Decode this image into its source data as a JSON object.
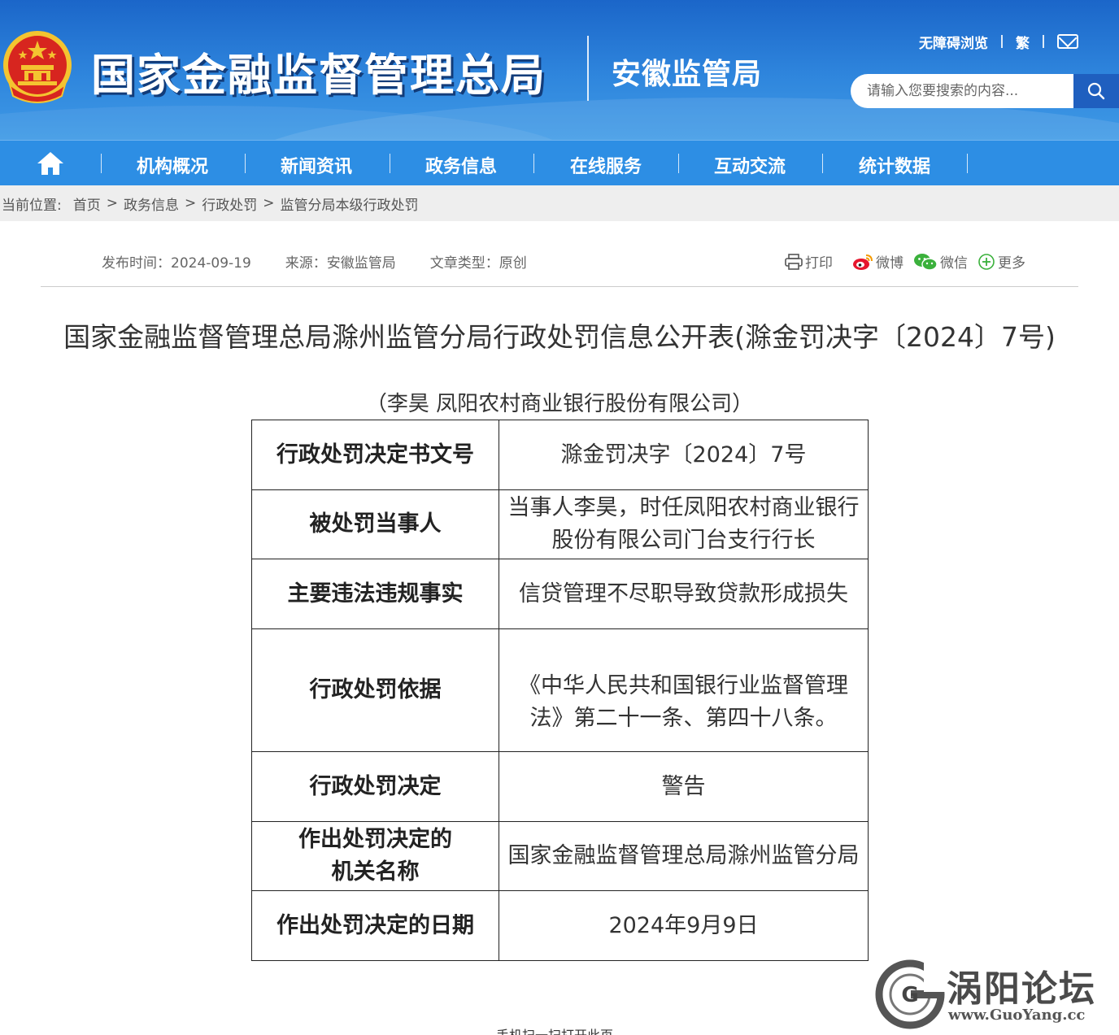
{
  "header": {
    "title": "国家金融监督管理总局",
    "subtitle": "安徽监管局",
    "accessibility_label": "无障碍浏览",
    "traditional_label": "繁",
    "search_placeholder": "请输入您要搜索的内容...",
    "icons": [
      "national-emblem",
      "mail-icon",
      "search-icon"
    ]
  },
  "nav": {
    "items": [
      "机构概况",
      "新闻资讯",
      "政务信息",
      "在线服务",
      "互动交流",
      "统计数据"
    ],
    "home_icon": "home-icon"
  },
  "breadcrumb": {
    "prefix": "当前位置:",
    "items": [
      "首页",
      "政务信息",
      "行政处罚",
      "监管分局本级行政处罚"
    ]
  },
  "article": {
    "publish": "发布时间：2024-09-19",
    "source": "来源：安徽监管局",
    "type": "文章类型：原创",
    "share": {
      "print": "打印",
      "weibo": "微博",
      "wechat": "微信",
      "more": "更多"
    },
    "title": "国家金融监督管理总局滁州监管分局行政处罚信息公开表(滁金罚决字〔2024〕7号)",
    "subtitle": "（李昊 凤阳农村商业银行股份有限公司）",
    "rows": [
      {
        "key": "行政处罚决定书文号",
        "value": "滁金罚决字〔2024〕7号"
      },
      {
        "key": "被处罚当事人",
        "value": "当事人李昊，时任凤阳农村商业银行股份有限公司门台支行行长"
      },
      {
        "key": "主要违法违规事实",
        "value": "信贷管理不尽职导致贷款形成损失"
      },
      {
        "key": "行政处罚依据",
        "value": "《中华人民共和国银行业监督管理法》第二十一条、第四十八条。"
      },
      {
        "key": "行政处罚决定",
        "value": "警告"
      },
      {
        "key": "作出处罚决定的机关名称",
        "value": "国家金融监督管理总局滁州监管分局"
      },
      {
        "key": "作出处罚决定的日期",
        "value": "2024年9月9日"
      }
    ],
    "qr_text": "手机扫一扫打开此页"
  },
  "watermark": {
    "title": "涡阳论坛",
    "url": "www.GuoYang.cc"
  },
  "colors": {
    "header_blue": "#1b66c9",
    "nav_blue": "#2d8ee4",
    "emblem_red": "#d7251f",
    "emblem_gold": "#f4c430"
  }
}
